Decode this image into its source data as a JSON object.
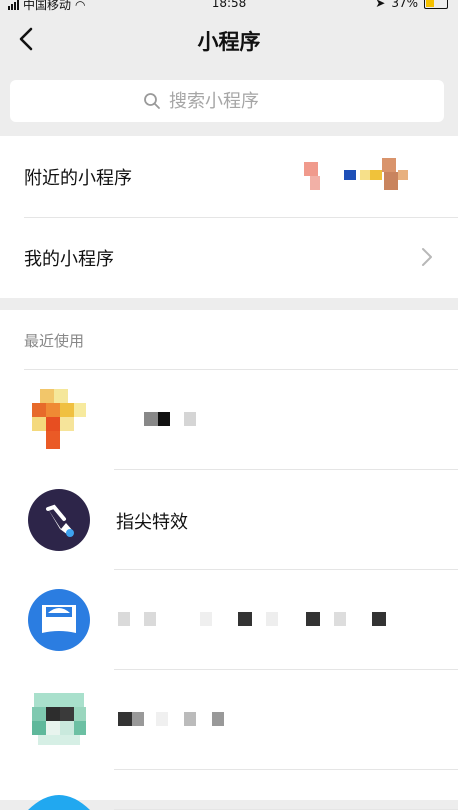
{
  "status": {
    "carrier": "中国移动",
    "time": "18:58",
    "battery": "37%"
  },
  "header": {
    "title": "小程序"
  },
  "search": {
    "placeholder": "搜索小程序"
  },
  "menu": {
    "nearby_label": "附近的小程序",
    "mine_label": "我的小程序"
  },
  "recent": {
    "label": "最近使用",
    "items": [
      {
        "name": "",
        "icon": "blurred-app-icon"
      },
      {
        "name": "指尖特效",
        "icon": "finger-hand-icon"
      },
      {
        "name": "",
        "icon": "ctrip-icon"
      },
      {
        "name": "",
        "icon": "blurred-app-icon"
      }
    ]
  },
  "colors": {
    "background": "#EDEDED",
    "white": "#FFFFFF",
    "divider": "#E5E5E5",
    "placeholder": "#A6A6A6"
  }
}
